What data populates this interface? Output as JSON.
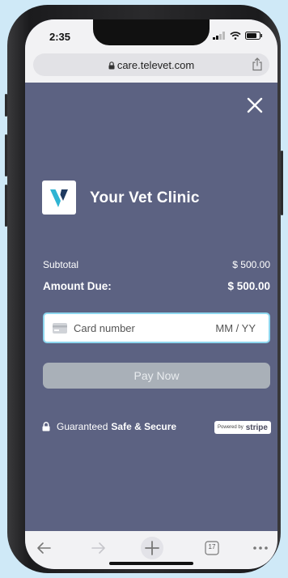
{
  "status": {
    "time": "2:35"
  },
  "browser": {
    "url": "care.televet.com",
    "tab_count": "17"
  },
  "clinic": {
    "name": "Your Vet Clinic"
  },
  "summary": {
    "subtotal_label": "Subtotal",
    "subtotal_value": "$ 500.00",
    "amount_due_label": "Amount Due:",
    "amount_due_value": "$ 500.00"
  },
  "payment": {
    "card_placeholder": "Card number",
    "expiry_placeholder": "MM / YY",
    "pay_label": "Pay Now"
  },
  "secure": {
    "prefix": "Guaranteed",
    "strong": "Safe & Secure"
  },
  "stripe": {
    "powered": "Powered by",
    "brand": "stripe"
  },
  "colors": {
    "page_bg": "#5c6282",
    "accent": "#28b7d6",
    "button_disabled": "#a9b0b8"
  }
}
